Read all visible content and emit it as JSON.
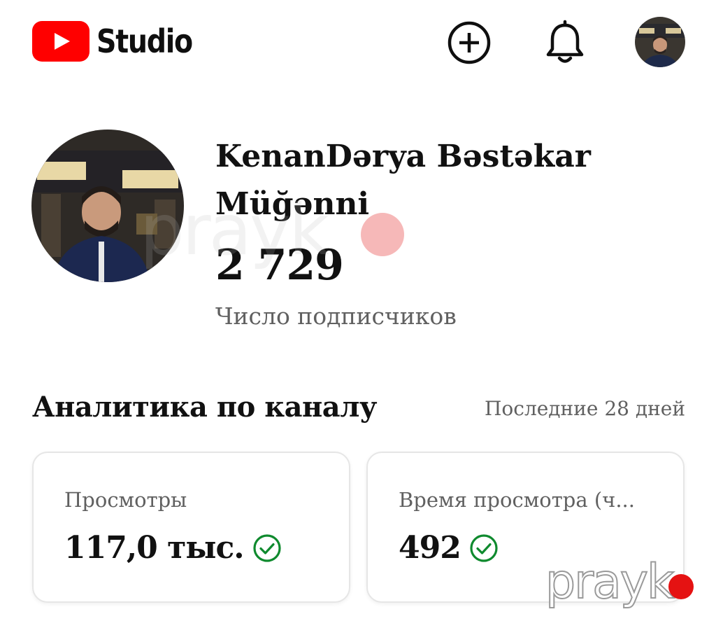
{
  "app": {
    "logo_text": "Studio",
    "brand_color": "#ff0000"
  },
  "header": {
    "create_icon": "create-plus-icon",
    "bell_icon": "bell-icon"
  },
  "channel": {
    "name": "KenanDərya Bəstəkar Müğənni",
    "subscribers": "2 729",
    "subscribers_label": "Число подписчиков"
  },
  "analytics": {
    "title": "Аналитика по каналу",
    "period": "Последние 28 дней",
    "cards": [
      {
        "label": "Просмотры",
        "value": "117,0 тыс.",
        "status_icon": "check-circle-icon",
        "status_color": "#0f8a2e"
      },
      {
        "label": "Время просмотра (ч...",
        "value": "492",
        "status_icon": "check-circle-icon",
        "status_color": "#0f8a2e"
      }
    ]
  },
  "watermark": {
    "text": "prayk",
    "dot_color": "#e51212"
  }
}
